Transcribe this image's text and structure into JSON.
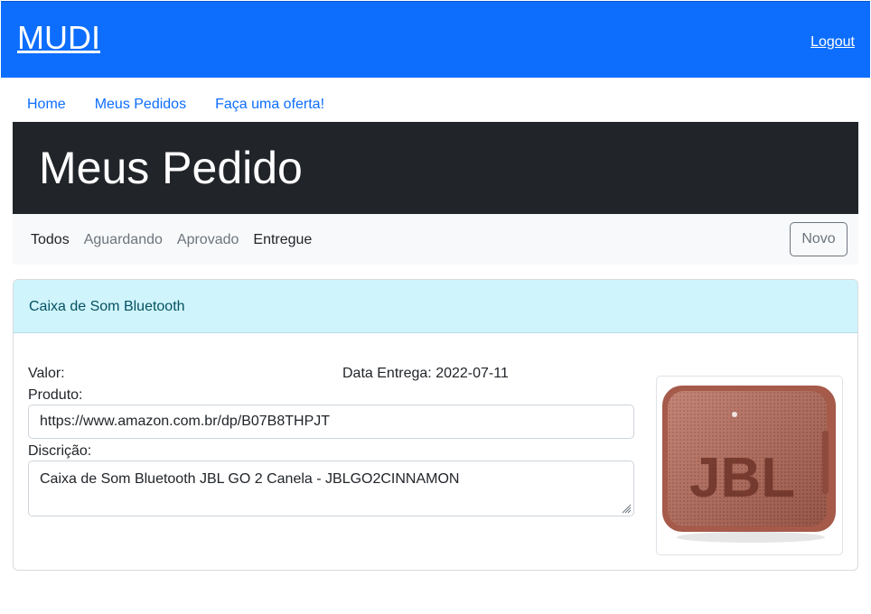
{
  "header": {
    "brand": "MUDI",
    "logout": "Logout",
    "color": "#0d6efd"
  },
  "nav": {
    "items": [
      "Home",
      "Meus Pedidos",
      "Faça uma oferta!"
    ]
  },
  "jumbotron": {
    "title": "Meus Pedido"
  },
  "filters": {
    "items": [
      {
        "label": "Todos",
        "active": true
      },
      {
        "label": "Aguardando",
        "active": false
      },
      {
        "label": "Aprovado",
        "active": false
      },
      {
        "label": "Entregue",
        "active": true
      }
    ],
    "new_button": "Novo"
  },
  "order": {
    "name": "Caixa de Som Bluetooth",
    "value_label": "Valor:",
    "value": "",
    "delivery_label": "Data Entrega:",
    "delivery_date": "2022-07-11",
    "product_label": "Produto:",
    "product_url": "https://www.amazon.com.br/dp/B07B8THPJT",
    "description_label": "Discrição:",
    "description": "Caixa de Som Bluetooth JBL GO 2 Canela - JBLGO2CINNAMON",
    "image_icon": "jbl-speaker-product-image",
    "image_brand_text": "JBL"
  }
}
